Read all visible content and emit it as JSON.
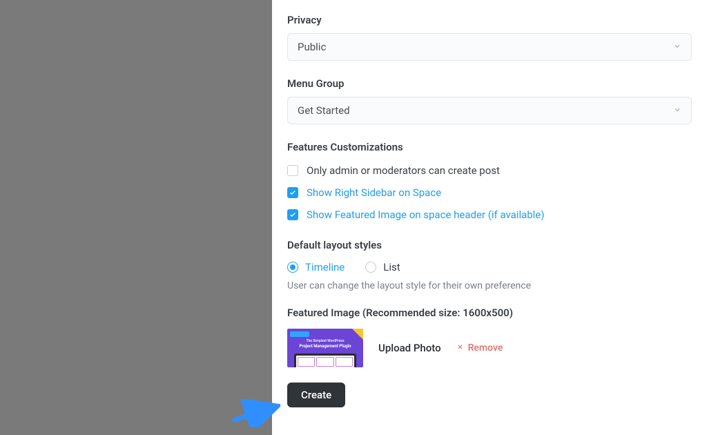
{
  "privacy": {
    "label": "Privacy",
    "value": "Public"
  },
  "menu_group": {
    "label": "Menu Group",
    "value": "Get Started"
  },
  "features": {
    "label": "Features Customizations",
    "opt_admin_only": {
      "label": "Only admin or moderators can create post",
      "checked": false
    },
    "opt_right_sidebar": {
      "label": "Show Right Sidebar on Space",
      "checked": true
    },
    "opt_featured_image": {
      "label": "Show Featured Image on space header (if available)",
      "checked": true
    }
  },
  "layout": {
    "label": "Default layout styles",
    "timeline": "Timeline",
    "list": "List",
    "helper": "User can change the layout style for their own preference"
  },
  "featured_image": {
    "label": "Featured Image (Recommended size: 1600x500)",
    "upload": "Upload Photo",
    "remove": "Remove",
    "thumb_line1": "The Simplest WordPress",
    "thumb_line2": "Project Management Plugin"
  },
  "actions": {
    "create": "Create"
  }
}
